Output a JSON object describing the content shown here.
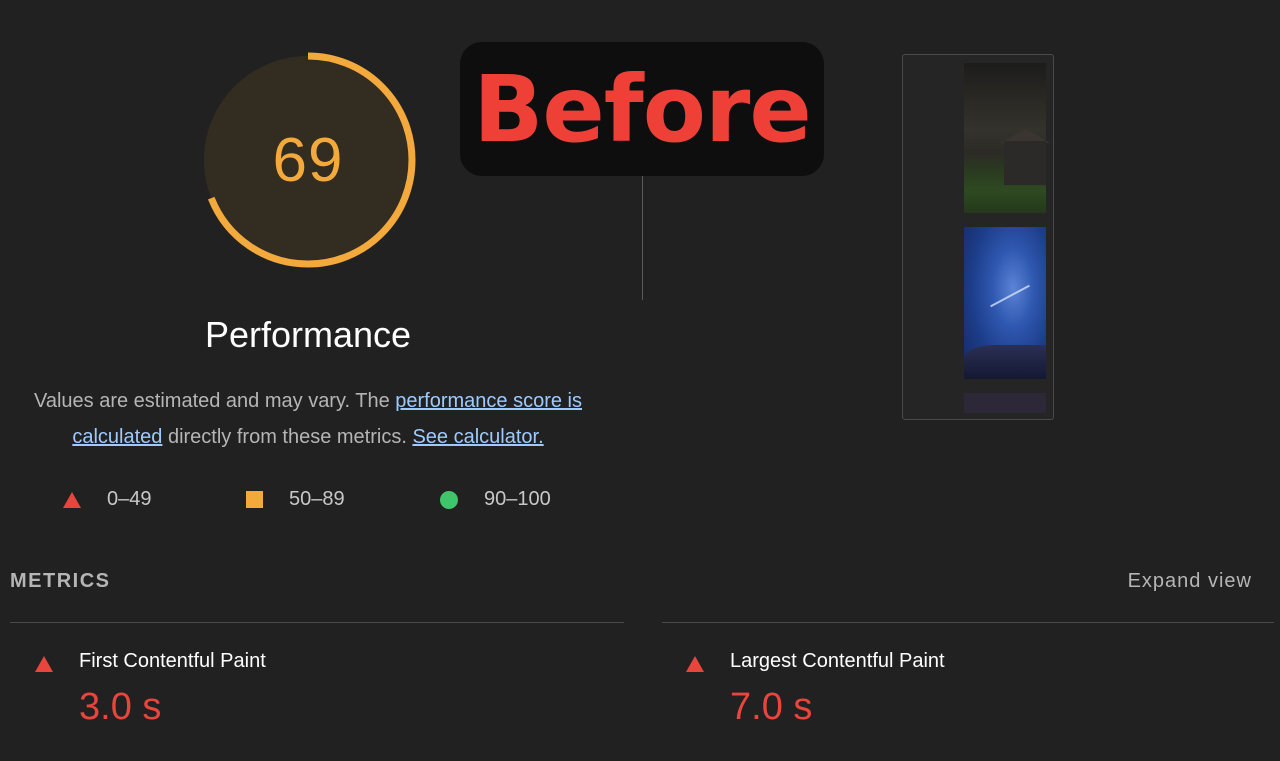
{
  "score": {
    "value": "69",
    "fraction": 0.69,
    "color": "#f4a93c",
    "category": "Performance"
  },
  "description": {
    "prefix": "Values are estimated and may vary. The ",
    "link_score": "performance score is calculated",
    "middle": " directly from these metrics. ",
    "link_calc": "See calculator."
  },
  "legend": [
    {
      "range": "0–49",
      "shape": "triangle",
      "color": "#e8453c"
    },
    {
      "range": "50–89",
      "shape": "square",
      "color": "#f4a93c"
    },
    {
      "range": "90–100",
      "shape": "circle",
      "color": "#3fc56a"
    }
  ],
  "overlay": {
    "label": "Before",
    "color": "#ef4038"
  },
  "metrics": {
    "section_label": "METRICS",
    "expand_label": "Expand view",
    "items": [
      {
        "name": "First Contentful Paint",
        "value": "3.0 s",
        "status": "fail"
      },
      {
        "name": "Largest Contentful Paint",
        "value": "7.0 s",
        "status": "fail"
      }
    ]
  }
}
